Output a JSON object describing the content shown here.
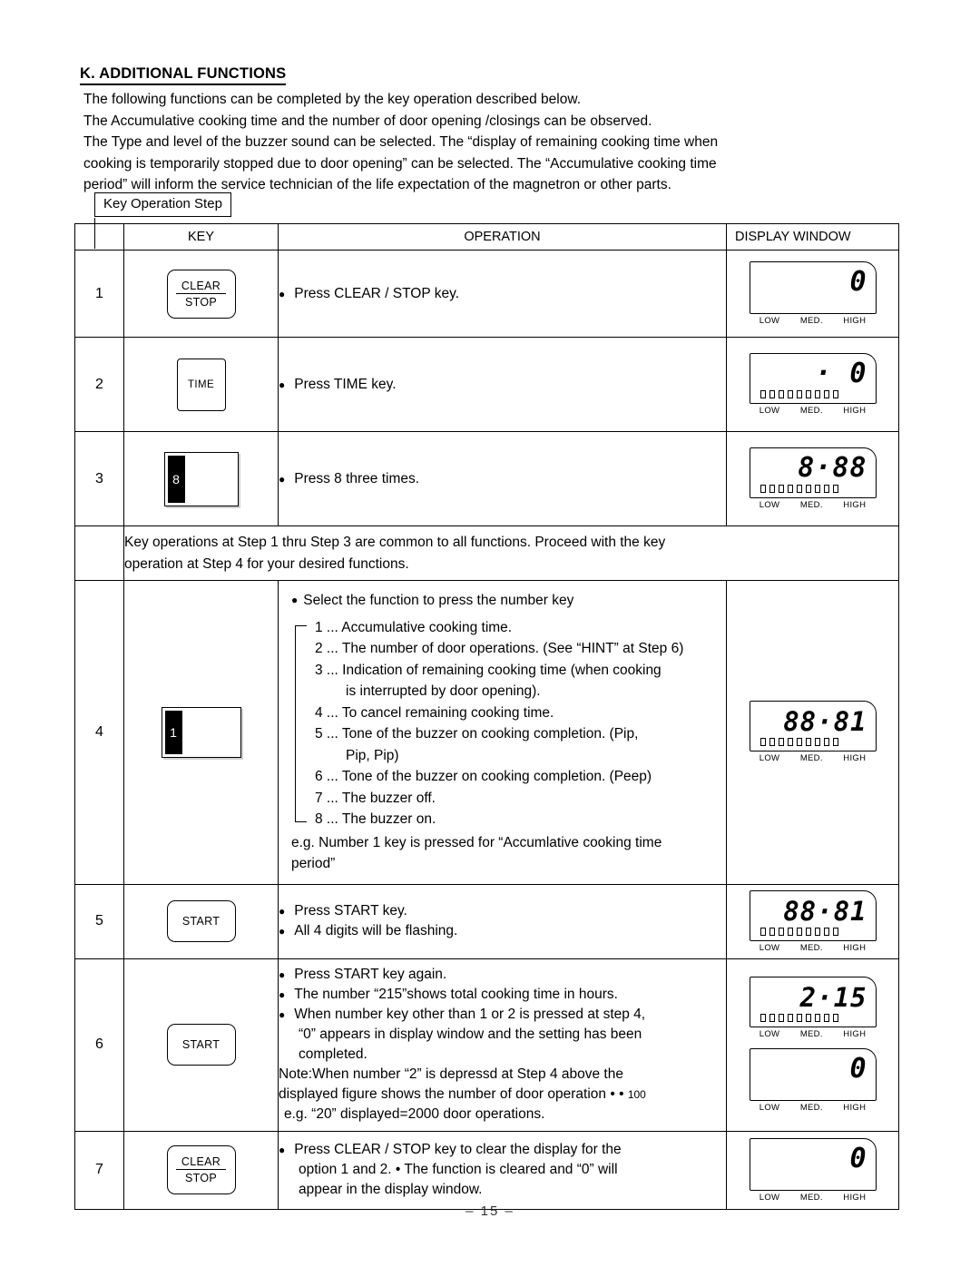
{
  "document": {
    "section_title": "K. ADDITIONAL FUNCTIONS",
    "intro_paragraphs": [
      "The following functions can be completed by the key operation described below.",
      "The Accumulative cooking time and the number of door opening /closings  can be observed.",
      "The Type and level of the buzzer sound can be selected. The “display of remaining cooking time when",
      "cooking is temporarily stopped due to  door opening” can be selected. The “Accumulative cooking time",
      "period” will inform the service technician of the life expectation of the magnetron or other parts."
    ],
    "callout_label": "Key Operation Step",
    "page_number": "–  15  –"
  },
  "table": {
    "headers": {
      "step": "",
      "key": "KEY",
      "operation": "OPERATION",
      "display": "DISPLAY WINDOW"
    },
    "rows": [
      {
        "step": "1",
        "key": {
          "type": "clear-stop",
          "line1": "CLEAR",
          "line2": "STOP"
        },
        "operation": [
          "Press CLEAR / STOP key."
        ],
        "display": {
          "digits": "0",
          "bars": false,
          "levels": [
            "LOW",
            "MED.",
            "HIGH"
          ]
        }
      },
      {
        "step": "2",
        "key": {
          "type": "plain",
          "label": "TIME"
        },
        "operation": [
          "Press TIME key."
        ],
        "display": {
          "digits": "· 0",
          "bars": true,
          "levels": [
            "LOW",
            "MED.",
            "HIGH"
          ]
        }
      },
      {
        "step": "3",
        "key": {
          "type": "number",
          "label": "8"
        },
        "operation": [
          "Press 8 three times."
        ],
        "display": {
          "digits": "8·88",
          "bars": true,
          "levels": [
            "LOW",
            "MED.",
            "HIGH"
          ]
        }
      }
    ],
    "note_row": {
      "line1": "Key operations at Step 1 thru Step 3 are common to all functions. Proceed with the key",
      "line2": "operation at Step 4 for your desired functions."
    },
    "step4": {
      "step": "4",
      "key": {
        "type": "number",
        "label": "1"
      },
      "lead": "Select the function to press the number key",
      "options": [
        "1 ... Accumulative cooking time.",
        "2 ... The number of door operations. (See “HINT” at Step 6)",
        "3 ... Indication of remaining cooking time (when cooking",
        "is interrupted by door opening).",
        "4 ... To cancel remaining cooking time.",
        "5 ... Tone of the buzzer on cooking completion. (Pip,",
        "Pip, Pip)",
        "6 ... Tone of the buzzer on cooking completion. (Peep)",
        "7 ... The buzzer off.",
        "8 ... The buzzer on."
      ],
      "option_indent": [
        false,
        false,
        false,
        true,
        false,
        false,
        true,
        false,
        false,
        false
      ],
      "eg_line1": "e.g. Number 1 key is pressed for  “Accumlative cooking time",
      "eg_line2": "period”",
      "display": {
        "digits": "88·81",
        "bars": true,
        "levels": [
          "LOW",
          "MED.",
          "HIGH"
        ]
      }
    },
    "step5": {
      "step": "5",
      "key": {
        "type": "plain",
        "label": "START"
      },
      "operation": [
        "Press START key.",
        "All 4 digits will be flashing."
      ],
      "display": {
        "digits": "88·81",
        "bars": true,
        "levels": [
          "LOW",
          "MED.",
          "HIGH"
        ]
      }
    },
    "step6": {
      "step": "6",
      "key": {
        "type": "plain",
        "label": "START"
      },
      "bullets": [
        "Press START key again.",
        "The number “215”shows total cooking time in hours.",
        "When number key other than 1 or 2 is pressed at step 4,"
      ],
      "cont_lines": [
        "“0” appears in display window and the setting has been",
        "completed."
      ],
      "note_lines": [
        "Note:When number “2” is depressd at Step 4 above the",
        "displayed figure shows the number of door operation • •",
        "e.g. “20” displayed=2000 door operations."
      ],
      "note_suffix": "100",
      "display_a": {
        "digits": "2·15",
        "bars": true,
        "levels": [
          "LOW",
          "MED.",
          "HIGH"
        ]
      },
      "display_b": {
        "digits": "0",
        "bars": false,
        "levels": [
          "LOW",
          "MED.",
          "HIGH"
        ]
      }
    },
    "step7": {
      "step": "7",
      "key": {
        "type": "clear-stop",
        "line1": "CLEAR",
        "line2": "STOP"
      },
      "lines": [
        "Press CLEAR / STOP key to clear the display for the",
        "option 1 and 2.  •    The function is cleared and “0” will",
        "appear in the display window."
      ],
      "display": {
        "digits": "0",
        "bars": false,
        "levels": [
          "LOW",
          "MED.",
          "HIGH"
        ]
      }
    }
  },
  "colors": {
    "ink": "#000000",
    "paper": "#ffffff"
  }
}
